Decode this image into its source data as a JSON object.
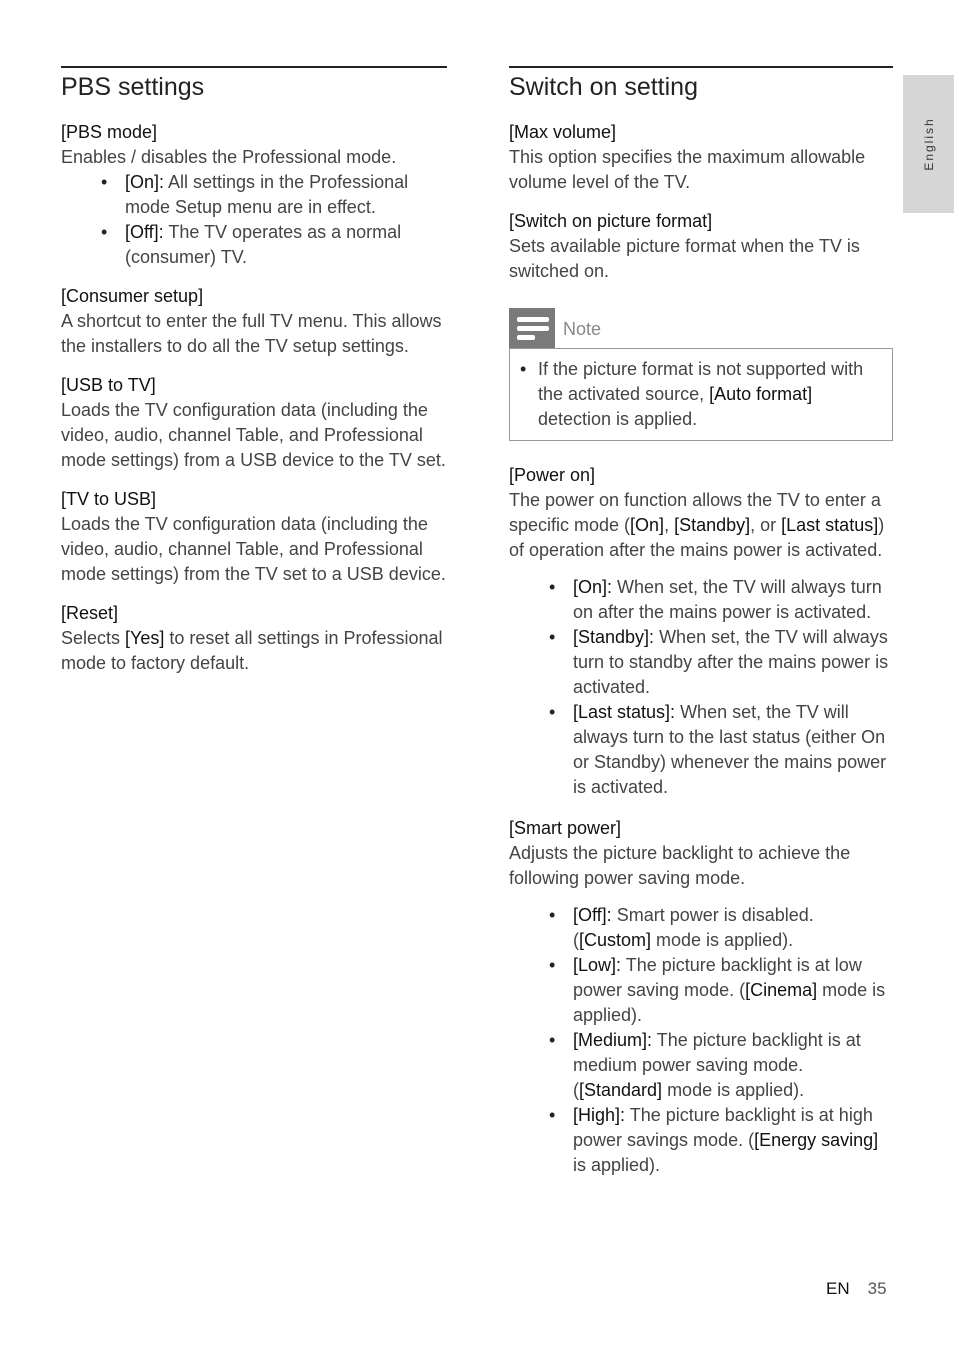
{
  "left": {
    "heading": "PBS settings",
    "sections": [
      {
        "title": "[PBS mode]",
        "text": "Enables / disables the Professional mode.",
        "bullets": [
          {
            "key": "[On]:",
            "text": " All settings in the Professional mode Setup menu are in effect."
          },
          {
            "key": "[Off]:",
            "text": " The TV operates as a normal (consumer) TV."
          }
        ]
      },
      {
        "title": "[Consumer setup]",
        "text": "A shortcut to enter the full TV menu. This allows the installers to do all the TV setup settings."
      },
      {
        "title": "[USB to TV]",
        "text": "Loads the TV configuration data (including the video,  audio,  channel Table, and Professional mode settings) from a USB device to the TV set."
      },
      {
        "title": "[TV to USB]",
        "text": "Loads the TV configuration data (including the video, audio, channel Table, and Professional mode settings) from the TV set to a USB device."
      },
      {
        "title": "[Reset]",
        "pre": "Selects ",
        "key": "[Yes]",
        "post": " to reset all settings in Professional mode to factory default."
      }
    ]
  },
  "right": {
    "heading": "Switch on setting",
    "max_volume": {
      "title": "[Max volume]",
      "text": "This option specifies the maximum allowable volume level of the TV."
    },
    "picture_format": {
      "title": "[Switch on picture format]",
      "text": "Sets available picture format when the TV is switched on."
    },
    "note": {
      "icon": "note-icon",
      "label": "Note",
      "pre": "If the picture format is not supported with the activated source, ",
      "key": "[Auto format]",
      "post": " detection is applied."
    },
    "power_on": {
      "title": "[Power on]",
      "t1": "The power on function allows the TV to enter a specific mode (",
      "k1": "[On]",
      "t2": ", ",
      "k2": "[Standby]",
      "t3": ", or ",
      "k3": "[Last status]",
      "t4": ") of operation after the mains power is activated.",
      "bullets": [
        {
          "key": "[On]:",
          "text": " When set, the TV will always turn on after the mains power is activated."
        },
        {
          "key": "[Standby]:",
          "text": " When set, the TV will always turn to standby after the mains power is activated."
        },
        {
          "key": "[Last status]:",
          "text": " When set, the TV will always turn to the last status (either On or Standby) whenever the mains power is activated."
        }
      ]
    },
    "smart_power": {
      "title": "[Smart power]",
      "text": "Adjusts the picture backlight to achieve the following power saving mode.",
      "bullets": [
        {
          "key": "[Off]:",
          "text": " Smart power is disabled. (",
          "key2": "[Custom]",
          "text2": " mode is applied)."
        },
        {
          "key": "[Low]:",
          "text": " The picture backlight is at low power saving mode. (",
          "key2": "[Cinema]",
          "text2": " mode is applied)."
        },
        {
          "key": "[Medium]:",
          "text": " The picture backlight is at medium power saving mode. (",
          "key2": "[Standard]",
          "text2": " mode is applied)."
        },
        {
          "key": "[High]:",
          "text": " The picture backlight is at high power savings mode. (",
          "key2": "[Energy saving]",
          "text2": " is applied)."
        }
      ]
    }
  },
  "side_tab": "English",
  "footer": {
    "lang": "EN",
    "page": "35"
  }
}
